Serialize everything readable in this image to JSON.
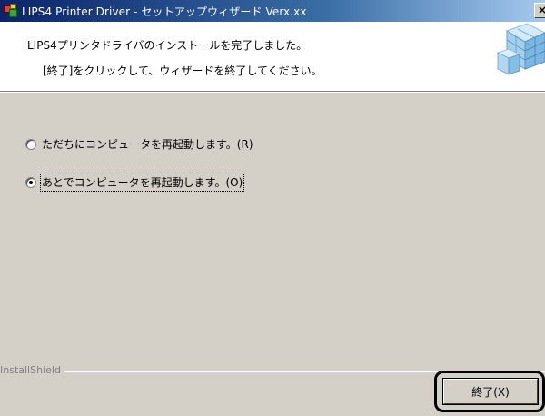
{
  "window": {
    "title": "LIPS4 Printer Driver - セットアップウィザード Verx.xx",
    "close_label": "×"
  },
  "header": {
    "line1": "LIPS4プリンタドライバのインストールを完了しました。",
    "line2": "[終了]をクリックして、ウィザードを終了してください。",
    "graphic_icon": "printer-cubes-graphic"
  },
  "options": [
    {
      "label": "ただちにコンピュータを再起動します。(R)",
      "checked": false
    },
    {
      "label": "あとでコンピュータを再起動します。(O)",
      "checked": true
    }
  ],
  "footer": {
    "brand": "InstallShield",
    "finish_label": "終了(X)"
  }
}
